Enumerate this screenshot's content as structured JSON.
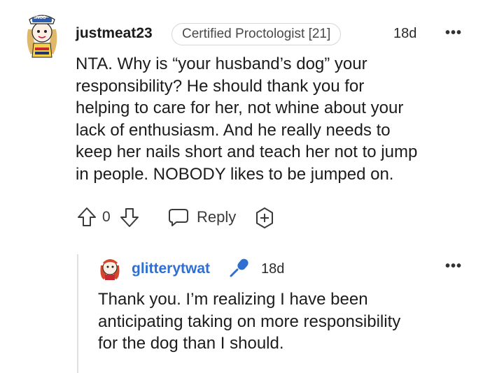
{
  "comment": {
    "username": "justmeat23",
    "flair": "Certified Proctologist [21]",
    "time": "18d",
    "more": "•••",
    "body": [
      "NTA. Why is “your husband’s dog” your",
      "responsibility? He should thank you for",
      "helping to care for her, not whine about your",
      "lack of enthusiasm. And he really needs to",
      "keep her nails short and teach her not to jump",
      "in people. NOBODY likes to be jumped on."
    ],
    "score": "0",
    "reply_label": "Reply",
    "avatar_badge": "SNOO"
  },
  "reply": {
    "username": "glitterytwat",
    "time": "18d",
    "more": "•••",
    "body": [
      "Thank you. I’m realizing I have been",
      "anticipating taking on more responsibility",
      "for the dog than I should."
    ]
  },
  "colors": {
    "reply_username": "#2f6fd1",
    "mic_icon": "#2f6fd1"
  }
}
